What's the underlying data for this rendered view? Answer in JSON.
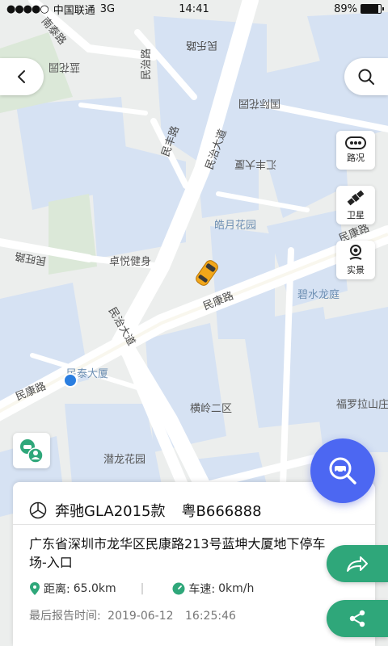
{
  "status_bar": {
    "carrier": "中国联通",
    "network": "3G",
    "time": "14:41",
    "battery": "89%",
    "battery_level": 0.89
  },
  "map": {
    "labels": {
      "road_nantaiyuan": "南泰路",
      "road_minkang": "民康路",
      "road_minkang2": "民康路",
      "road_minkang3": "民康路",
      "road_minzhi": "民治大道",
      "road_minzhi2": "民治大道",
      "road_minle": "民乐路",
      "road_minfeng": "民丰路",
      "road_minwang": "民旺路",
      "road_minyi": "民治路",
      "place_haoyue": "皓月花园",
      "place_bishui": "碧水龙庭",
      "place_zhuoyue": "卓悦健身",
      "place_mintai": "民泰大厦",
      "place_hengling2": "横岭二区",
      "place_qianlong": "潜龙花园",
      "place_fuluola": "福罗拉山庄",
      "place_huifeng": "汇丰大厦",
      "place_guojiayuan": "国际花园",
      "place_lanhua": "蓝花园"
    },
    "colors": {
      "residential": "#d4e0f2",
      "road": "#ffffff",
      "background": "#eceeed"
    }
  },
  "controls": {
    "back_icon": "chevron-left-icon",
    "search_icon": "search-icon",
    "traffic_label": "路况",
    "satellite_label": "卫星",
    "streetview_label": "实景"
  },
  "vehicle": {
    "brand_icon": "mercedes-logo-icon",
    "model": "奔驰GLA2015款",
    "plate": "粤B666888",
    "address": "广东省深圳市龙华区民康路213号蓝坤大厦地下停车场-入口",
    "distance_label": "距离:",
    "distance_value": "65.0km",
    "speed_label": "车速:",
    "speed_value": "0km/h",
    "report_label": "最后报告时间:",
    "report_date": "2019-06-12",
    "report_time": "16:25:46"
  },
  "theme": {
    "accent_blue": "#4c67f2",
    "accent_green": "#2fa77a",
    "car_color": "#f2a71a"
  }
}
